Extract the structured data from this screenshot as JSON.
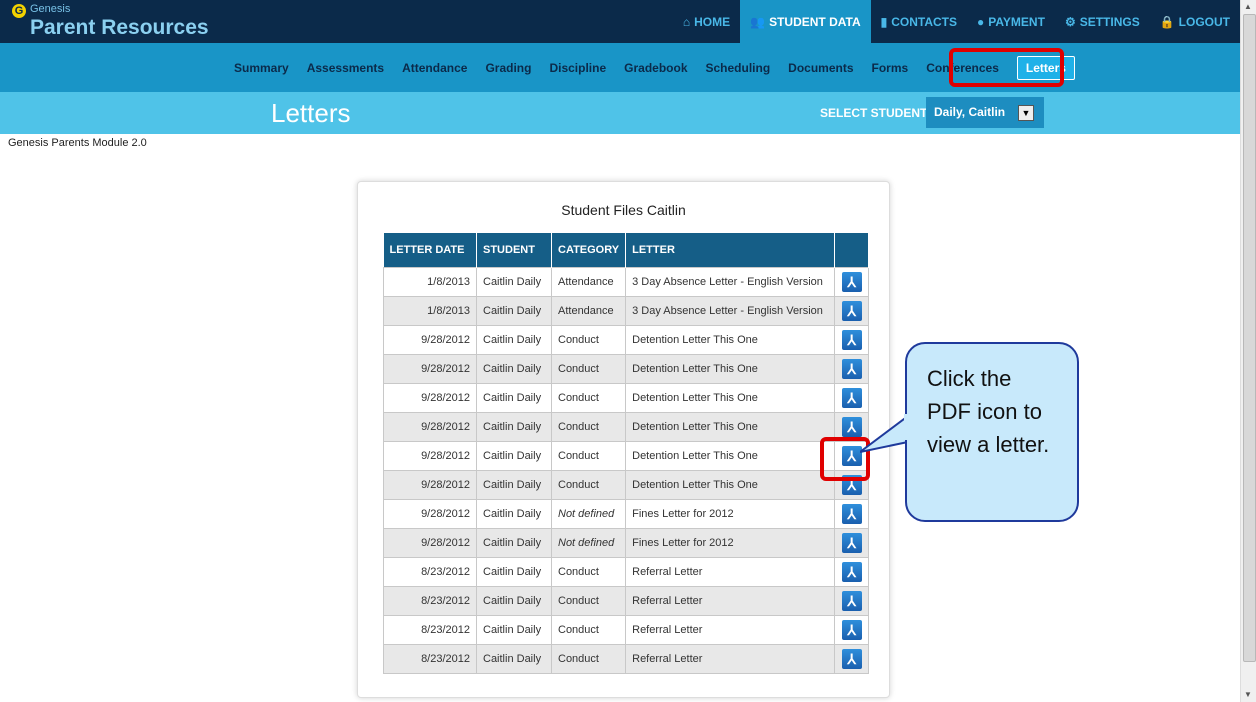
{
  "header": {
    "logo_small": "Genesis",
    "logo_main": "Parent Resources",
    "nav": [
      {
        "icon": "home-icon",
        "glyph": "⌂",
        "label": "HOME"
      },
      {
        "icon": "users-icon",
        "glyph": "👥",
        "label": "STUDENT DATA"
      },
      {
        "icon": "contacts-icon",
        "glyph": "▮",
        "label": "CONTACTS"
      },
      {
        "icon": "payment-icon",
        "glyph": "●",
        "label": "PAYMENT"
      },
      {
        "icon": "gear-icon",
        "glyph": "⚙",
        "label": "SETTINGS"
      },
      {
        "icon": "lock-icon",
        "glyph": "🔒",
        "label": "LOGOUT"
      }
    ]
  },
  "subnav": [
    "Summary",
    "Assessments",
    "Attendance",
    "Grading",
    "Discipline",
    "Gradebook",
    "Scheduling",
    "Documents",
    "Forms",
    "Conferences",
    "Letters"
  ],
  "title": {
    "page_title": "Letters",
    "select_label": "SELECT STUDENT:",
    "selected_student": "Daily, Caitlin"
  },
  "module_label": "Genesis Parents Module 2.0",
  "card": {
    "title": "Student Files Caitlin",
    "columns": [
      "LETTER DATE",
      "STUDENT",
      "CATEGORY",
      "LETTER",
      ""
    ],
    "rows": [
      {
        "date": "1/8/2013",
        "student": "Caitlin Daily",
        "category": "Attendance",
        "letter": "3 Day Absence Letter - English Version"
      },
      {
        "date": "1/8/2013",
        "student": "Caitlin Daily",
        "category": "Attendance",
        "letter": "3 Day Absence Letter - English Version"
      },
      {
        "date": "9/28/2012",
        "student": "Caitlin Daily",
        "category": "Conduct",
        "letter": "Detention Letter This One"
      },
      {
        "date": "9/28/2012",
        "student": "Caitlin Daily",
        "category": "Conduct",
        "letter": "Detention Letter This One"
      },
      {
        "date": "9/28/2012",
        "student": "Caitlin Daily",
        "category": "Conduct",
        "letter": "Detention Letter This One"
      },
      {
        "date": "9/28/2012",
        "student": "Caitlin Daily",
        "category": "Conduct",
        "letter": "Detention Letter This One"
      },
      {
        "date": "9/28/2012",
        "student": "Caitlin Daily",
        "category": "Conduct",
        "letter": "Detention Letter This One"
      },
      {
        "date": "9/28/2012",
        "student": "Caitlin Daily",
        "category": "Conduct",
        "letter": "Detention Letter This One"
      },
      {
        "date": "9/28/2012",
        "student": "Caitlin Daily",
        "category": "Not defined",
        "letter": "Fines Letter for 2012"
      },
      {
        "date": "9/28/2012",
        "student": "Caitlin Daily",
        "category": "Not defined",
        "letter": "Fines Letter for 2012"
      },
      {
        "date": "8/23/2012",
        "student": "Caitlin Daily",
        "category": "Conduct",
        "letter": "Referral Letter"
      },
      {
        "date": "8/23/2012",
        "student": "Caitlin Daily",
        "category": "Conduct",
        "letter": "Referral Letter"
      },
      {
        "date": "8/23/2012",
        "student": "Caitlin Daily",
        "category": "Conduct",
        "letter": "Referral Letter"
      },
      {
        "date": "8/23/2012",
        "student": "Caitlin Daily",
        "category": "Conduct",
        "letter": "Referral Letter"
      }
    ]
  },
  "callout": {
    "text": "Click the PDF icon to view a letter."
  },
  "colors": {
    "header_bg": "#0b2a4a",
    "subnav_bg": "#1995c7",
    "titleband_bg": "#4fc3e8",
    "highlight": "#e00000"
  }
}
